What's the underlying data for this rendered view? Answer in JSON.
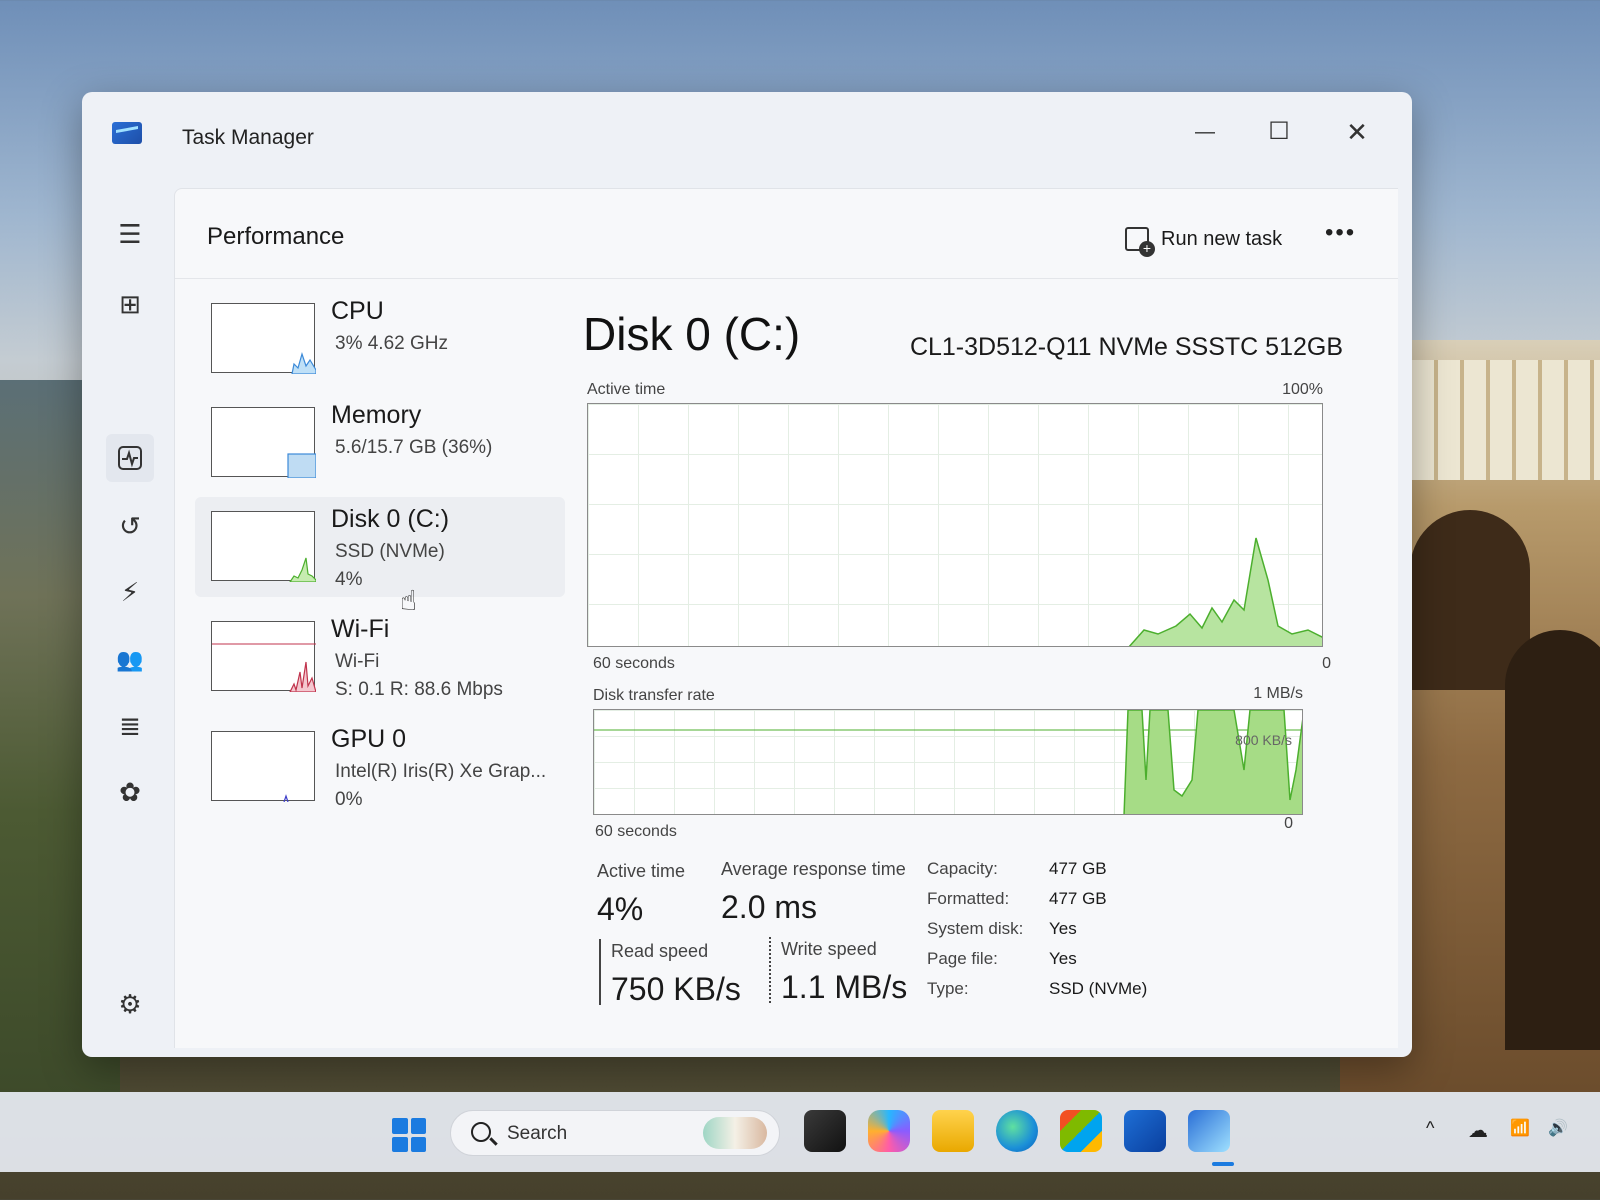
{
  "window": {
    "title": "Task Manager",
    "minimize_glyph": "—",
    "maximize_glyph": "☐",
    "close_glyph": "✕"
  },
  "nav": {
    "items": [
      {
        "name": "menu-icon",
        "glyph": "☰"
      },
      {
        "name": "processes-icon",
        "glyph": "⊞"
      },
      {
        "name": "performance-icon",
        "glyph": "〜"
      },
      {
        "name": "app-history-icon",
        "glyph": "↺"
      },
      {
        "name": "startup-apps-icon",
        "glyph": "⚡"
      },
      {
        "name": "users-icon",
        "glyph": "👥"
      },
      {
        "name": "details-icon",
        "glyph": "≣"
      },
      {
        "name": "services-icon",
        "glyph": "✿"
      }
    ],
    "settings_glyph": "⚙",
    "active": "performance"
  },
  "header": {
    "title": "Performance",
    "run_new_task": "Run new task",
    "more": "•••"
  },
  "devices": [
    {
      "name": "CPU",
      "line1": "3%  4.62 GHz",
      "line2": "",
      "color": "#3c8ad8"
    },
    {
      "name": "Memory",
      "line1": "5.6/15.7 GB (36%)",
      "line2": "",
      "color": "#3c8ad8"
    },
    {
      "name": "Disk 0 (C:)",
      "line1": "SSD (NVMe)",
      "line2": "4%",
      "color": "#4caf2e"
    },
    {
      "name": "Wi-Fi",
      "line1": "Wi-Fi",
      "line2": "S: 0.1  R: 88.6 Mbps",
      "color": "#c0334c"
    },
    {
      "name": "GPU 0",
      "line1": "Intel(R) Iris(R) Xe Grap...",
      "line2": "0%",
      "color": "#3c3cc8"
    }
  ],
  "detail": {
    "title": "Disk 0 (C:)",
    "model": "CL1-3D512-Q11 NVMe SSSTC 512GB",
    "active_time_graph": {
      "label": "Active time",
      "max_label": "100%",
      "time_label": "60 seconds",
      "min_label": "0"
    },
    "transfer_graph": {
      "label": "Disk transfer rate",
      "max_label": "1 MB/s",
      "mid_label": "800 KB/s",
      "time_label": "60 seconds",
      "min_label": "0"
    },
    "stats": {
      "active_time_label": "Active time",
      "active_time_value": "4%",
      "avg_response_label": "Average response time",
      "avg_response_value": "2.0 ms",
      "read_speed_label": "Read speed",
      "read_speed_value": "750 KB/s",
      "write_speed_label": "Write speed",
      "write_speed_value": "1.1 MB/s"
    },
    "properties": [
      {
        "key": "Capacity:",
        "value": "477 GB"
      },
      {
        "key": "Formatted:",
        "value": "477 GB"
      },
      {
        "key": "System disk:",
        "value": "Yes"
      },
      {
        "key": "Page file:",
        "value": "Yes"
      },
      {
        "key": "Type:",
        "value": "SSD (NVMe)"
      }
    ]
  },
  "taskbar": {
    "search_placeholder": "Search",
    "apps": [
      "file-explorer-icon",
      "copilot-icon",
      "folder-icon",
      "edge-icon",
      "store-icon",
      "outlook-icon",
      "task-manager-icon"
    ],
    "tray": {
      "chevron": "^",
      "wifi": "📶",
      "volume": "🔊"
    }
  },
  "colors": {
    "accent": "#1565d8",
    "disk_green": "#4caf2e",
    "disk_fill": "#9fdc7e"
  }
}
